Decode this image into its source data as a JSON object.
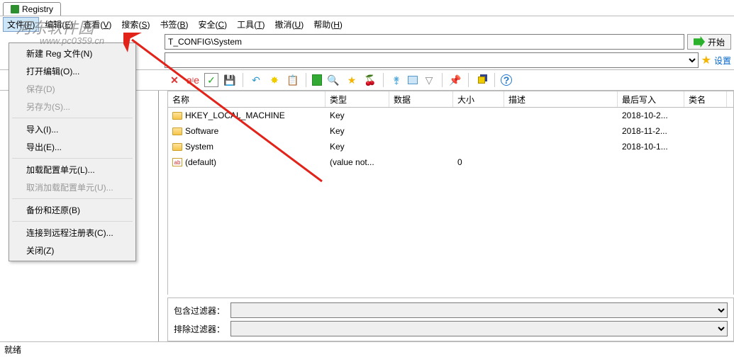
{
  "tab": {
    "title": "Registry"
  },
  "menubar": [
    {
      "label": "文件",
      "key": "F"
    },
    {
      "label": "编辑",
      "key": "E"
    },
    {
      "label": "查看",
      "key": "V"
    },
    {
      "label": "搜索",
      "key": "S"
    },
    {
      "label": "书签",
      "key": "B"
    },
    {
      "label": "安全",
      "key": "C"
    },
    {
      "label": "工具",
      "key": "T"
    },
    {
      "label": "撤消",
      "key": "U"
    },
    {
      "label": "帮助",
      "key": "H"
    }
  ],
  "path": {
    "value": "T_CONFIG\\System",
    "start_label": "开始"
  },
  "combo": {
    "settings_label": "设置"
  },
  "file_menu": [
    {
      "label": "新建 Reg 文件(N)",
      "type": "item"
    },
    {
      "label": "打开编辑(O)...",
      "type": "item"
    },
    {
      "label": "保存(D)",
      "type": "item",
      "disabled": true
    },
    {
      "label": "另存为(S)...",
      "type": "item",
      "disabled": true
    },
    {
      "type": "sep"
    },
    {
      "label": "导入(I)...",
      "type": "item"
    },
    {
      "label": "导出(E)...",
      "type": "item"
    },
    {
      "type": "sep"
    },
    {
      "label": "加载配置单元(L)...",
      "type": "item"
    },
    {
      "label": "取消加载配置单元(U)...",
      "type": "item",
      "disabled": true
    },
    {
      "type": "sep"
    },
    {
      "label": "备份和还原(B)",
      "type": "item"
    },
    {
      "type": "sep"
    },
    {
      "label": "连接到远程注册表(C)...",
      "type": "item"
    },
    {
      "label": "关闭(Z)",
      "type": "item"
    }
  ],
  "columns": {
    "name": "名称",
    "type": "类型",
    "data": "数据",
    "size": "大小",
    "desc": "描述",
    "modified": "最后写入",
    "class": "类名"
  },
  "rows": [
    {
      "icon": "folder",
      "name": "HKEY_LOCAL_MACHINE",
      "type": "Key",
      "data": "",
      "size": "",
      "desc": "",
      "modified": "2018-10-2...",
      "class": ""
    },
    {
      "icon": "folder",
      "name": "Software",
      "type": "Key",
      "data": "",
      "size": "",
      "desc": "",
      "modified": "2018-11-2...",
      "class": ""
    },
    {
      "icon": "folder",
      "name": "System",
      "type": "Key",
      "data": "",
      "size": "",
      "desc": "",
      "modified": "2018-10-1...",
      "class": ""
    },
    {
      "icon": "string",
      "name": "(default)",
      "type": "(value not...",
      "data": "",
      "size": "0",
      "desc": "",
      "modified": "",
      "class": ""
    }
  ],
  "filters": {
    "include": "包含过滤器：",
    "exclude": "排除过滤器："
  },
  "status": "就绪",
  "watermark": {
    "main": "河东软件园",
    "url": "www.pc0359.cn"
  },
  "toolbar_icons": [
    "delete-icon",
    "rename-icon",
    "checkbox-icon",
    "save-icon",
    "undo-icon",
    "new-icon",
    "paste-icon",
    "sheet-icon",
    "search-icon",
    "star-icon",
    "cherry-icon",
    "branch-icon",
    "window-icon",
    "filter-icon",
    "pin-icon",
    "copy-icon",
    "help-icon"
  ]
}
